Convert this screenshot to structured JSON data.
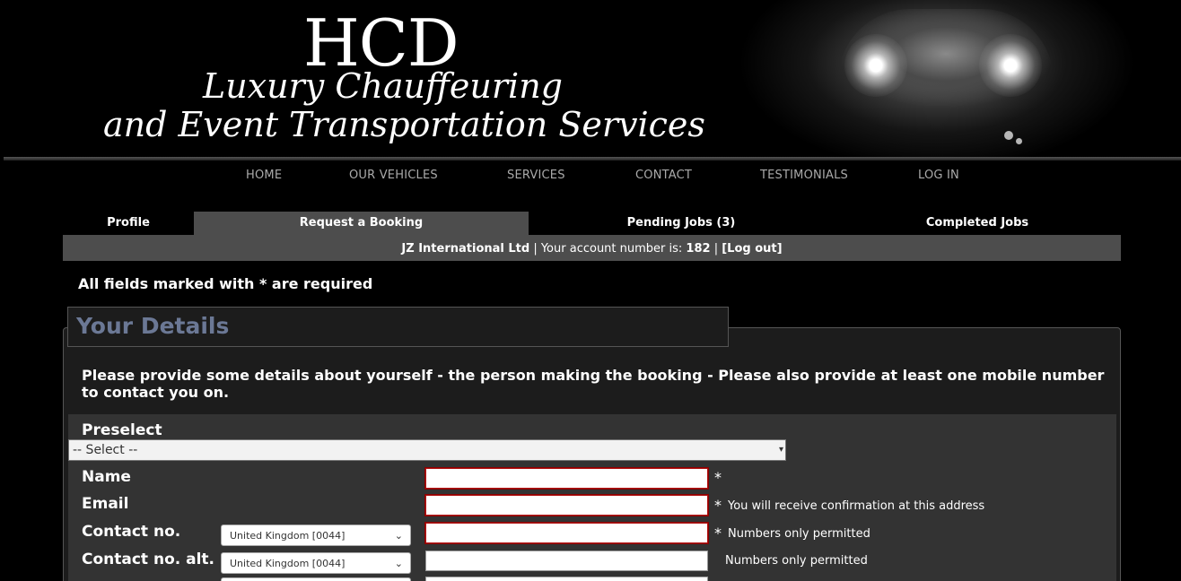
{
  "brand": {
    "hcd": "HCD",
    "tagline1": "Luxury Chauffeuring",
    "tagline2": "and Event Transportation Services"
  },
  "nav": [
    "HOME",
    "OUR VEHICLES",
    "SERVICES",
    "CONTACT",
    "TESTIMONIALS",
    "LOG IN"
  ],
  "tabs": {
    "profile": "Profile",
    "request": "Request a Booking",
    "pending": "Pending Jobs (3)",
    "completed": "Completed Jobs"
  },
  "account": {
    "company": "JZ International Ltd",
    "sep1": " | ",
    "text": "Your account number is: ",
    "number": "182",
    "sep2": " | ",
    "logout": "[Log out]"
  },
  "required_note": "All fields marked with * are required",
  "section": {
    "title": "Your Details",
    "intro": "Please provide some details about yourself - the person making the booking - Please also provide at least one mobile number to contact you on."
  },
  "form": {
    "preselect_label": "Preselect",
    "preselect_value": "-- Select --",
    "name_label": "Name",
    "email_label": "Email",
    "contact_label": "Contact no.",
    "contact_alt_label": "Contact no. alt.",
    "country_value": "United Kingdom [0044]",
    "star": "*",
    "email_hint": "You will receive confirmation at this address",
    "numbers_hint": "Numbers only permitted"
  }
}
